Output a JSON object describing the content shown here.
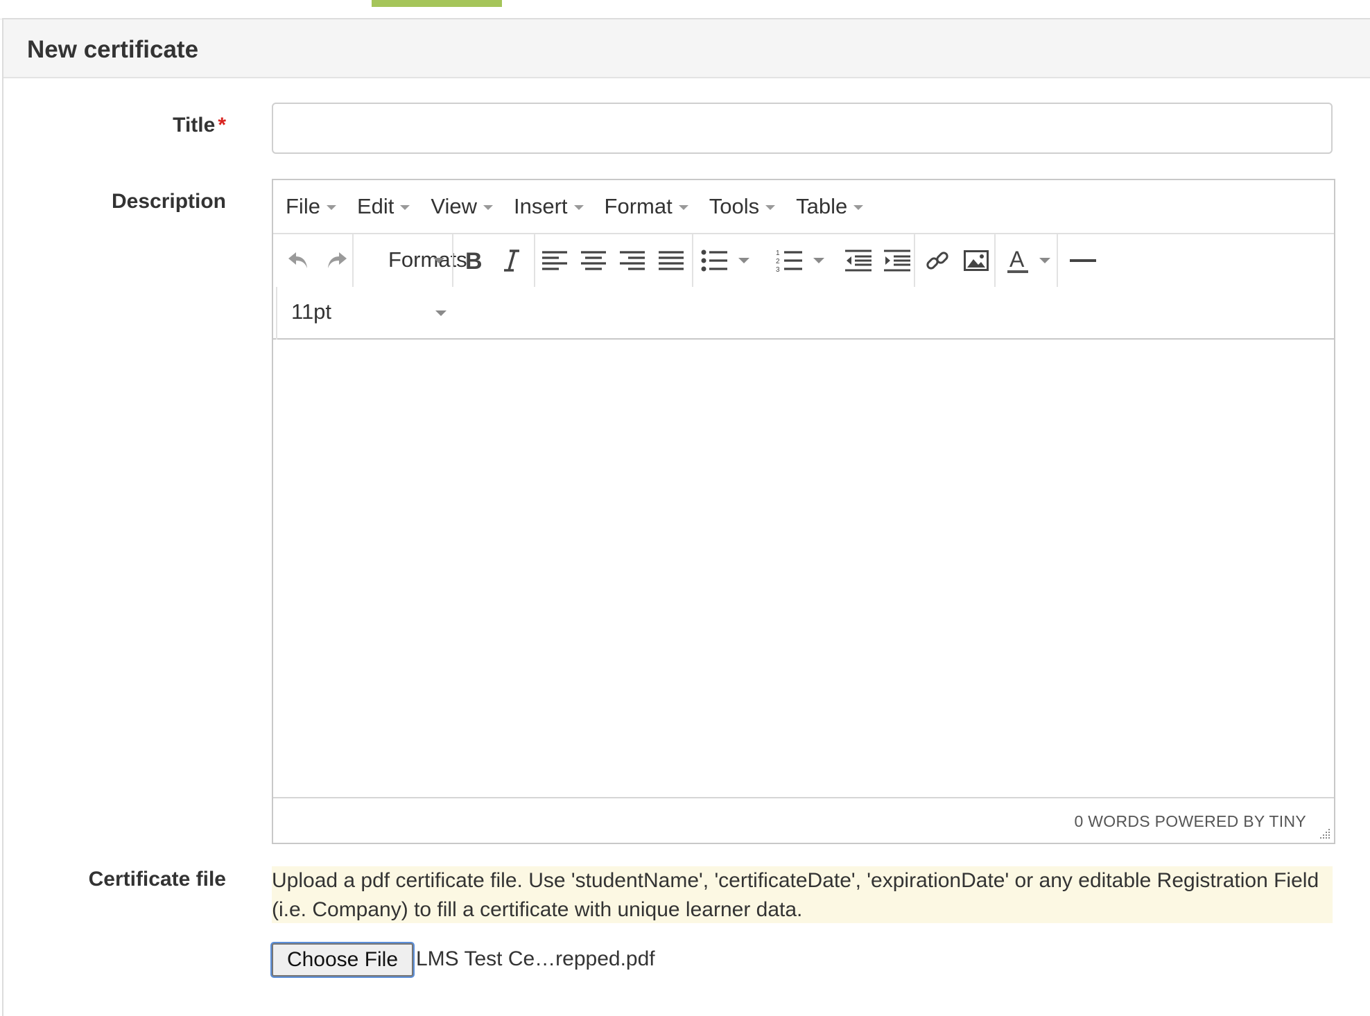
{
  "header": {
    "title": "New certificate"
  },
  "form": {
    "title_label": "Title",
    "required_mark": "*",
    "title_value": "",
    "description_label": "Description",
    "certificate_label": "Certificate file"
  },
  "editor": {
    "menus": [
      "File",
      "Edit",
      "View",
      "Insert",
      "Format",
      "Tools",
      "Table"
    ],
    "formats_label": "Formats",
    "font_size": "11pt",
    "status": "0 WORDS POWERED BY TINY",
    "toolbar_icons": [
      "undo-icon",
      "redo-icon",
      "bold-icon",
      "italic-icon",
      "align-left-icon",
      "align-center-icon",
      "align-right-icon",
      "align-justify-icon",
      "bullet-list-icon",
      "numbered-list-icon",
      "outdent-icon",
      "indent-icon",
      "link-icon",
      "image-icon",
      "text-color-icon",
      "horizontal-rule-icon"
    ]
  },
  "upload": {
    "help_text": "Upload a pdf certificate file. Use 'studentName', 'certificateDate', 'expirationDate' or any editable Registration Field (i.e. Company) to fill a certificate with unique learner data.",
    "button_label": "Choose File",
    "file_name": "LMS Test Ce…repped.pdf"
  },
  "colors": {
    "accent": "#a5c55a",
    "required": "#d9231f",
    "help_bg": "#fcf8e3"
  }
}
